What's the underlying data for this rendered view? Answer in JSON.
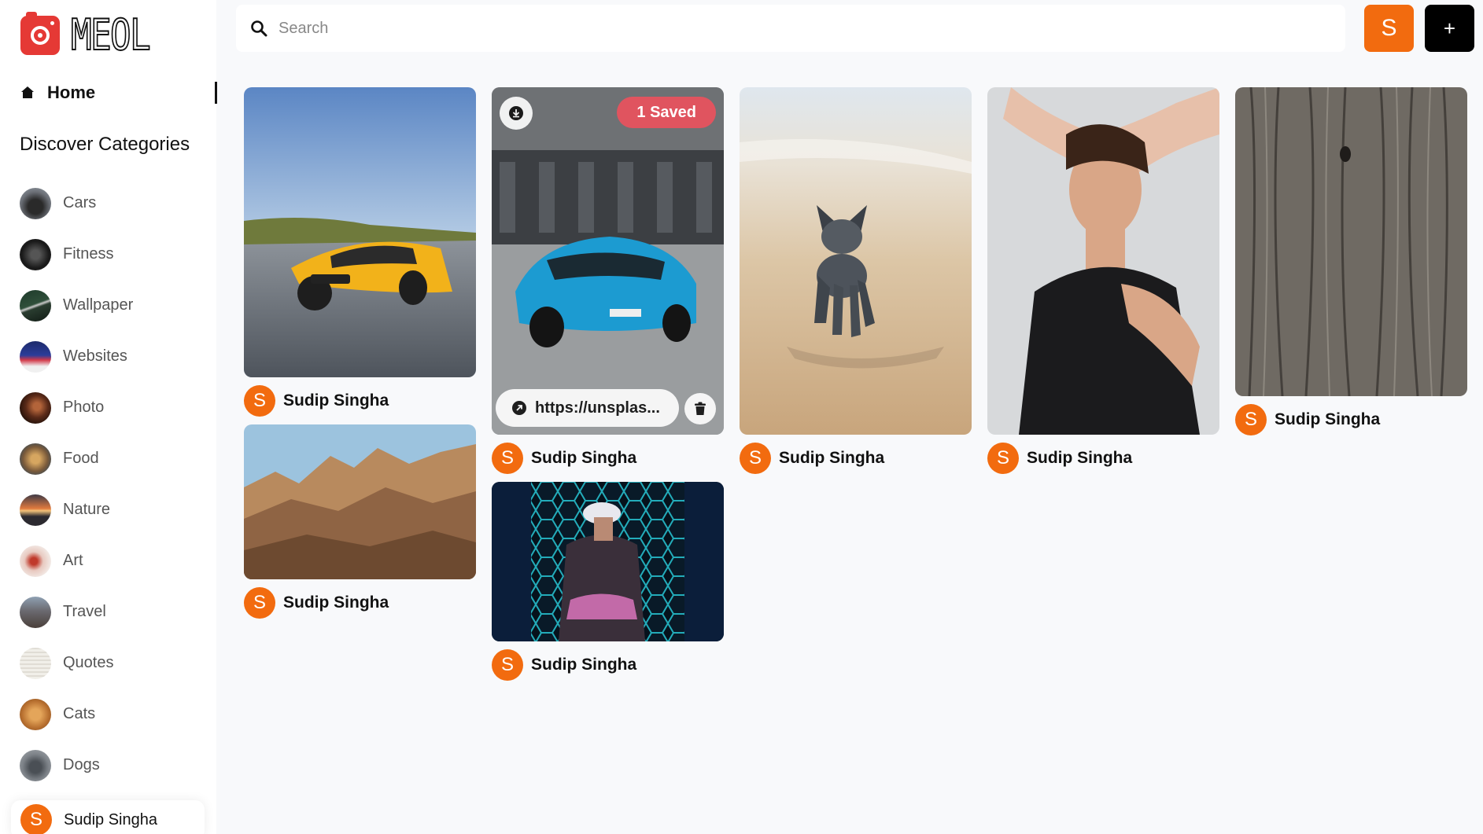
{
  "app": {
    "logo_text": "MEOL"
  },
  "nav": {
    "home_label": "Home"
  },
  "sidebar": {
    "discover_title": "Discover Categories",
    "categories": [
      {
        "label": "Cars"
      },
      {
        "label": "Fitness"
      },
      {
        "label": "Wallpaper"
      },
      {
        "label": "Websites"
      },
      {
        "label": "Photo"
      },
      {
        "label": "Food"
      },
      {
        "label": "Nature"
      },
      {
        "label": "Art"
      },
      {
        "label": "Travel"
      },
      {
        "label": "Quotes"
      },
      {
        "label": "Cats"
      },
      {
        "label": "Dogs"
      }
    ],
    "user": {
      "initial": "S",
      "name": "Sudip Singha"
    }
  },
  "search": {
    "placeholder": "Search",
    "value": ""
  },
  "header": {
    "profile_initial": "S",
    "add_label": "+"
  },
  "pins": [
    {
      "name": "Sudip Singha",
      "initial": "S"
    },
    {
      "name": "Sudip Singha",
      "initial": "S"
    },
    {
      "name": "Sudip Singha",
      "initial": "S",
      "saved_label": "1 Saved",
      "link_text": "https://unsplas..."
    },
    {
      "name": "Sudip Singha",
      "initial": "S"
    },
    {
      "name": "Sudip Singha",
      "initial": "S"
    },
    {
      "name": "Sudip Singha",
      "initial": "S"
    },
    {
      "name": "Sudip Singha",
      "initial": "S"
    }
  ],
  "colors": {
    "accent": "#f26b0f",
    "saved": "#e0545f",
    "logo": "#e53935",
    "background": "#f8f9fb"
  }
}
